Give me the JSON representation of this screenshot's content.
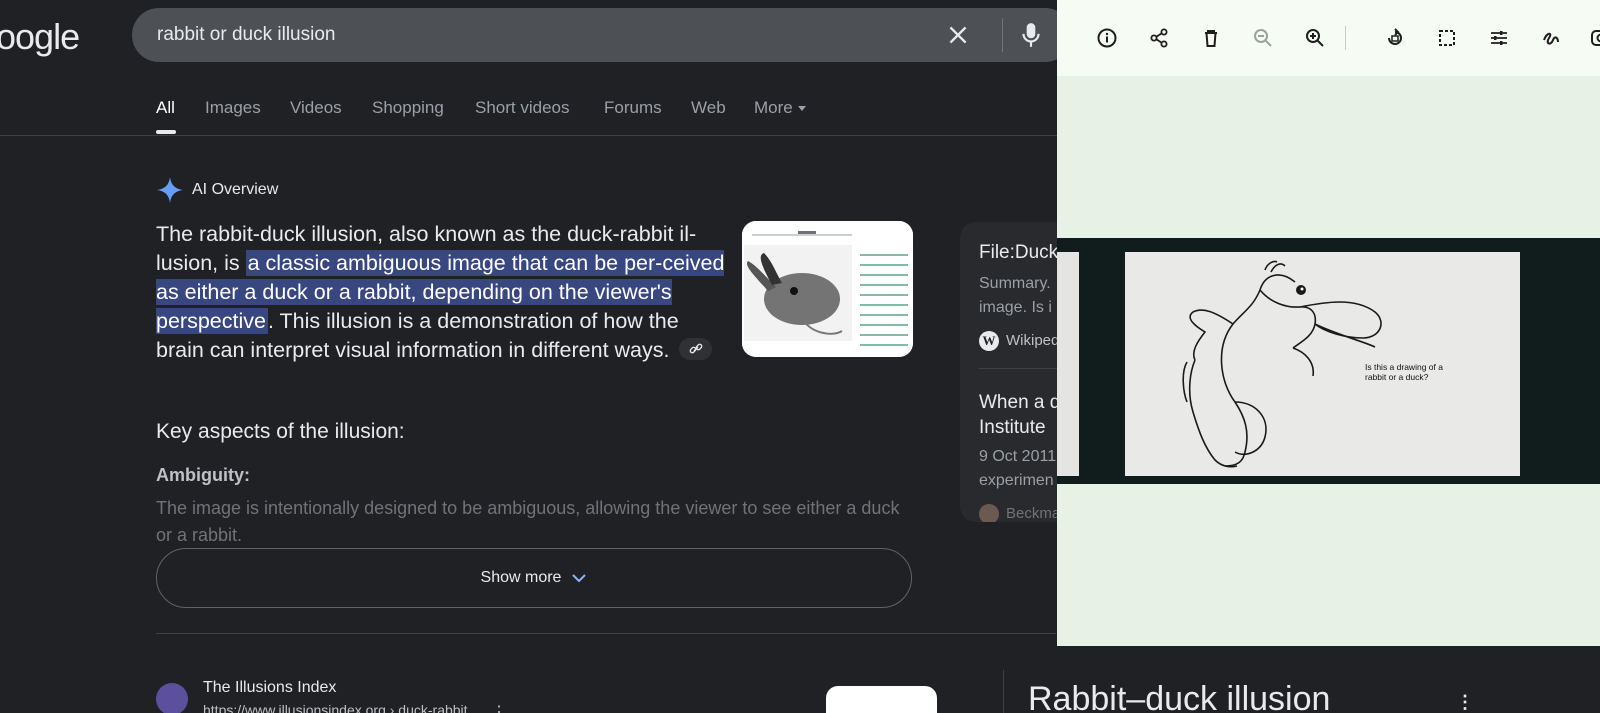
{
  "logo": "oogle",
  "search": {
    "query": "rabbit or duck illusion"
  },
  "tabs": [
    {
      "label": "All",
      "active": true
    },
    {
      "label": "Images"
    },
    {
      "label": "Videos"
    },
    {
      "label": "Shopping"
    },
    {
      "label": "Short videos"
    },
    {
      "label": "Forums"
    },
    {
      "label": "Web"
    },
    {
      "label": "More"
    }
  ],
  "ai_overview": {
    "heading": "AI Overview",
    "text_before": "The rabbit-duck illusion, also known as the duck-rabbit il-lusion, is ",
    "text_highlight": "a classic ambiguous image that can be per-ceived as either a duck or a rabbit, depending on the viewer's perspective",
    "text_after": ". This illusion is a demonstration of how the brain can interpret visual information in different ways.",
    "key_heading": "Key aspects of the illusion:",
    "aspect_title": "Ambiguity:",
    "aspect_text": "The image is intentionally designed to be ambiguous, allowing the viewer to see either a duck or a rabbit.",
    "show_more": "Show more"
  },
  "side_card": {
    "item1_title": "File:Duck",
    "item1_snippet_1": "Summary.",
    "item1_snippet_2": "image. Is i",
    "item1_source": "Wikiped",
    "item2_title_1": "When a d",
    "item2_title_2": "Institute",
    "item2_date": "9 Oct 2011",
    "item2_snippet": "experimen",
    "item2_source": "Beckma"
  },
  "result": {
    "site": "The Illusions Index",
    "url": "https://www.illusionsindex.org › duck-rabbit"
  },
  "knowledge_panel": {
    "title": "Rabbit–duck illusion"
  },
  "viewer": {
    "caption": "Is this a drawing of a rabbit or a duck?",
    "toolbar": [
      "info-icon",
      "share-icon",
      "delete-icon",
      "zoom-out-icon",
      "zoom-in-icon",
      "rotate-icon",
      "crop-icon",
      "adjust-icon",
      "markup-icon",
      "lens-icon"
    ]
  },
  "colors": {
    "background": "#202124",
    "highlight": "#394780",
    "viewer_bg": "#e8f1e6"
  }
}
